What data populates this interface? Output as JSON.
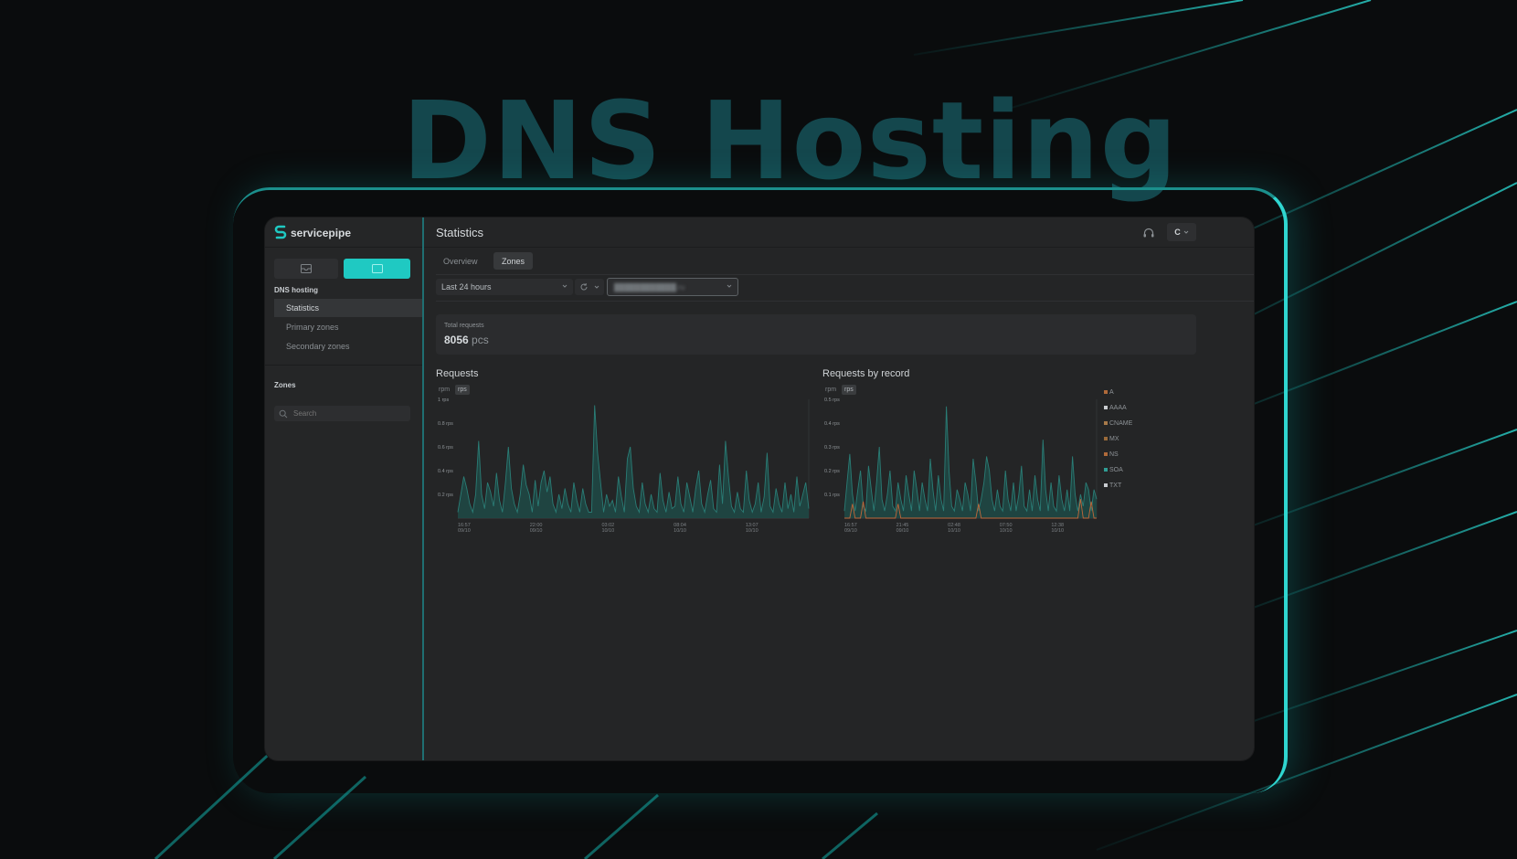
{
  "hero": {
    "title": "DNS Hosting"
  },
  "colors": {
    "accent": "#1fc9c2",
    "series_fill": "#1e4a47",
    "series_line": "#2a7d76",
    "orange": "#c0673a",
    "background": "#0a0c0d"
  },
  "brand": {
    "name": "servicepipe"
  },
  "sidebar": {
    "switcher_icons": [
      "inbox-icon",
      "dns-icon"
    ],
    "section_dns": "DNS hosting",
    "items": [
      {
        "label": "Statistics",
        "active": true
      },
      {
        "label": "Primary zones",
        "active": false
      },
      {
        "label": "Secondary zones",
        "active": false
      }
    ],
    "section_zones": "Zones",
    "search_placeholder": "Search"
  },
  "header": {
    "title": "Statistics",
    "account_label": "C",
    "support_icon": "headset-icon"
  },
  "tabs": [
    {
      "label": "Overview",
      "active": false
    },
    {
      "label": "Zones",
      "active": true
    }
  ],
  "filters": {
    "range": "Last 24 hours",
    "zone": "████████████.ru"
  },
  "summary": {
    "label": "Total requests",
    "value": "8056",
    "unit": "pcs"
  },
  "charts": {
    "requests": {
      "title": "Requests",
      "toggle": [
        "rpm",
        "rps"
      ],
      "active": "rps"
    },
    "by_record": {
      "title": "Requests by record",
      "toggle": [
        "rpm",
        "rps"
      ],
      "active": "rps"
    }
  },
  "chart_data": [
    {
      "type": "area",
      "title": "Requests",
      "y_tick_labels": [
        "1 rps",
        "0.8 rps",
        "0.6 rps",
        "0.4 rps",
        "0.2 rps"
      ],
      "y_ticks": [
        1,
        0.8,
        0.6,
        0.4,
        0.2
      ],
      "ylim": [
        0,
        1
      ],
      "x_tick_labels": [
        [
          "16:57",
          "09/10"
        ],
        [
          "22:00",
          "09/10"
        ],
        [
          "03:02",
          "10/10"
        ],
        [
          "08:04",
          "10/10"
        ],
        [
          "13:07",
          "10/10"
        ]
      ],
      "series": [
        {
          "values": [
            0.05,
            0.2,
            0.35,
            0.25,
            0.12,
            0.05,
            0.2,
            0.65,
            0.2,
            0.08,
            0.3,
            0.22,
            0.1,
            0.38,
            0.15,
            0.05,
            0.3,
            0.6,
            0.25,
            0.12,
            0.05,
            0.2,
            0.45,
            0.28,
            0.2,
            0.05,
            0.32,
            0.1,
            0.3,
            0.4,
            0.22,
            0.35,
            0.12,
            0.05,
            0.2,
            0.08,
            0.25,
            0.12,
            0.05,
            0.3,
            0.15,
            0.05,
            0.25,
            0.12,
            0.05,
            0.05,
            0.95,
            0.55,
            0.3,
            0.05,
            0.2,
            0.1,
            0.15,
            0.05,
            0.35,
            0.18,
            0.05,
            0.5,
            0.6,
            0.25,
            0.1,
            0.05,
            0.3,
            0.12,
            0.05,
            0.2,
            0.08,
            0.05,
            0.38,
            0.15,
            0.05,
            0.22,
            0.08,
            0.1,
            0.35,
            0.12,
            0.05,
            0.3,
            0.18,
            0.05,
            0.25,
            0.4,
            0.12,
            0.05,
            0.2,
            0.32,
            0.08,
            0.05,
            0.45,
            0.12,
            0.65,
            0.35,
            0.1,
            0.05,
            0.22,
            0.08,
            0.05,
            0.4,
            0.15,
            0.05,
            0.12,
            0.3,
            0.05,
            0.18,
            0.55,
            0.1,
            0.05,
            0.25,
            0.12,
            0.05,
            0.3,
            0.08,
            0.2,
            0.05,
            0.35,
            0.1,
            0.2,
            0.3,
            0.08
          ]
        }
      ]
    },
    {
      "type": "area",
      "title": "Requests by record",
      "y_tick_labels": [
        "0.5 rps",
        "0.4 rps",
        "0.3 rps",
        "0.2 rps",
        "0.1 rps"
      ],
      "y_ticks": [
        0.5,
        0.4,
        0.3,
        0.2,
        0.1
      ],
      "ylim": [
        0,
        0.5
      ],
      "x_tick_labels": [
        [
          "16:57",
          "09/10"
        ],
        [
          "21:45",
          "09/10"
        ],
        [
          "02:48",
          "10/10"
        ],
        [
          "07:50",
          "10/10"
        ],
        [
          "12:38",
          "10/10"
        ]
      ],
      "legend": [
        "A",
        "AAAA",
        "CNAME",
        "MX",
        "NS",
        "SOA",
        "TXT"
      ],
      "legend_colors": [
        "#b06a3a",
        "#c9ccd0",
        "#a87a4a",
        "#9a6a3a",
        "#b06a3a",
        "#2f9d94",
        "#c9ccd0"
      ],
      "series": [
        {
          "name": "SOA",
          "values": [
            0.03,
            0.15,
            0.27,
            0.1,
            0.03,
            0.12,
            0.2,
            0.05,
            0.03,
            0.22,
            0.12,
            0.03,
            0.15,
            0.3,
            0.08,
            0.03,
            0.1,
            0.2,
            0.05,
            0.03,
            0.15,
            0.08,
            0.03,
            0.18,
            0.1,
            0.03,
            0.2,
            0.12,
            0.03,
            0.15,
            0.08,
            0.03,
            0.25,
            0.12,
            0.03,
            0.18,
            0.08,
            0.03,
            0.47,
            0.2,
            0.05,
            0.03,
            0.12,
            0.08,
            0.03,
            0.15,
            0.1,
            0.03,
            0.25,
            0.15,
            0.03,
            0.08,
            0.15,
            0.26,
            0.2,
            0.08,
            0.03,
            0.12,
            0.05,
            0.03,
            0.2,
            0.08,
            0.03,
            0.15,
            0.03,
            0.1,
            0.22,
            0.05,
            0.03,
            0.12,
            0.03,
            0.18,
            0.08,
            0.03,
            0.33,
            0.12,
            0.03,
            0.15,
            0.05,
            0.03,
            0.18,
            0.08,
            0.03,
            0.12,
            0.03,
            0.26,
            0.1,
            0.03,
            0.1,
            0.05,
            0.15,
            0.12,
            0.03,
            0.12,
            0.08
          ]
        },
        {
          "name": "A",
          "values": [
            0.0,
            0.0,
            0.0,
            0.06,
            0.0,
            0.0,
            0.0,
            0.07,
            0.0,
            0.0,
            0.0,
            0.0,
            0.0,
            0.0,
            0.0,
            0.0,
            0.0,
            0.0,
            0.0,
            0.0,
            0.06,
            0.0,
            0.0,
            0.0,
            0.0,
            0.0,
            0.0,
            0.0,
            0.0,
            0.0,
            0.0,
            0.0,
            0.0,
            0.0,
            0.0,
            0.0,
            0.0,
            0.0,
            0.0,
            0.0,
            0.0,
            0.0,
            0.0,
            0.0,
            0.0,
            0.0,
            0.0,
            0.0,
            0.0,
            0.0,
            0.06,
            0.0,
            0.0,
            0.0,
            0.0,
            0.0,
            0.0,
            0.0,
            0.0,
            0.0,
            0.0,
            0.0,
            0.0,
            0.0,
            0.0,
            0.0,
            0.0,
            0.0,
            0.0,
            0.0,
            0.0,
            0.0,
            0.0,
            0.0,
            0.0,
            0.0,
            0.0,
            0.0,
            0.0,
            0.0,
            0.0,
            0.0,
            0.0,
            0.0,
            0.0,
            0.0,
            0.0,
            0.0,
            0.08,
            0.0,
            0.0,
            0.0,
            0.07,
            0.0,
            0.0
          ]
        }
      ]
    }
  ]
}
